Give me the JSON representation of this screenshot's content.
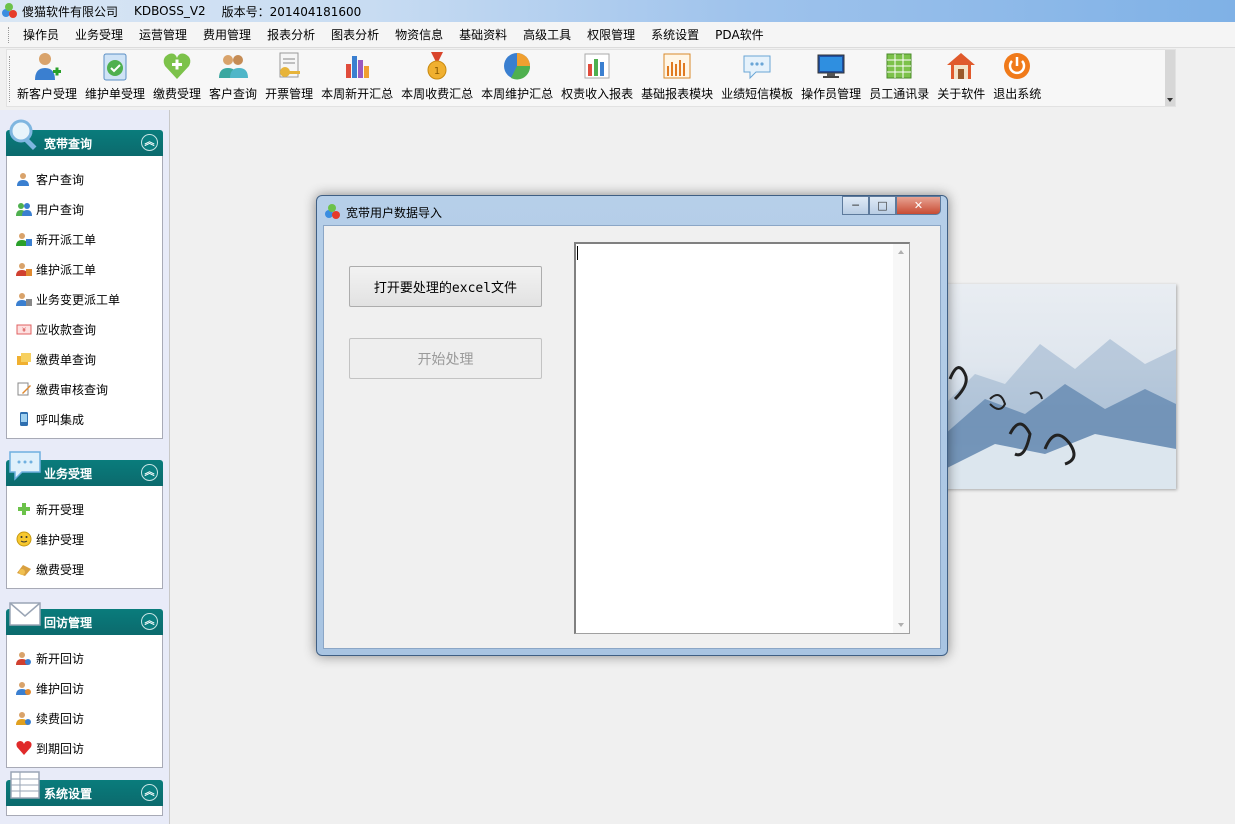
{
  "titlebar": {
    "company": "傻猫软件有限公司",
    "product": "KDBOSS_V2",
    "version": "版本号：201404181600"
  },
  "menu": [
    "操作员",
    "业务受理",
    "运营管理",
    "费用管理",
    "报表分析",
    "图表分析",
    "物资信息",
    "基础资料",
    "高级工具",
    "权限管理",
    "系统设置",
    "PDA软件"
  ],
  "toolbar": [
    {
      "label": "新客户受理",
      "icon": "add-user-icon"
    },
    {
      "label": "维护单受理",
      "icon": "checklist-icon"
    },
    {
      "label": "缴费受理",
      "icon": "heart-plus-icon"
    },
    {
      "label": "客户查询",
      "icon": "users-icon"
    },
    {
      "label": "开票管理",
      "icon": "invoice-key-icon"
    },
    {
      "label": "本周新开汇总",
      "icon": "bar-chart-icon"
    },
    {
      "label": "本周收费汇总",
      "icon": "medal-icon"
    },
    {
      "label": "本周维护汇总",
      "icon": "pie-chart-icon"
    },
    {
      "label": "权责收入报表",
      "icon": "column-chart-icon"
    },
    {
      "label": "基础报表模块",
      "icon": "report-chart-icon"
    },
    {
      "label": "业绩短信模板",
      "icon": "message-bubble-icon"
    },
    {
      "label": "操作员管理",
      "icon": "monitor-icon"
    },
    {
      "label": "员工通讯录",
      "icon": "spreadsheet-icon"
    },
    {
      "label": "关于软件",
      "icon": "home-icon"
    },
    {
      "label": "退出系统",
      "icon": "power-icon"
    }
  ],
  "sidebar": {
    "groups": [
      {
        "title": "宽带查询",
        "icon": "magnifier-icon",
        "items": [
          {
            "label": "客户查询",
            "icon": "customer-icon"
          },
          {
            "label": "用户查询",
            "icon": "group-icon"
          },
          {
            "label": "新开派工单",
            "icon": "new-order-icon"
          },
          {
            "label": "维护派工单",
            "icon": "repair-order-icon"
          },
          {
            "label": "业务变更派工单",
            "icon": "change-order-icon"
          },
          {
            "label": "应收款查询",
            "icon": "receivable-icon"
          },
          {
            "label": "缴费单查询",
            "icon": "payment-icon"
          },
          {
            "label": "缴费审核查询",
            "icon": "audit-icon"
          },
          {
            "label": "呼叫集成",
            "icon": "phone-icon"
          }
        ]
      },
      {
        "title": "业务受理",
        "icon": "chat-bubble-icon",
        "items": [
          {
            "label": "新开受理",
            "icon": "plus-icon"
          },
          {
            "label": "维护受理",
            "icon": "smiley-icon"
          },
          {
            "label": "缴费受理",
            "icon": "money-icon"
          }
        ]
      },
      {
        "title": "回访管理",
        "icon": "envelope-icon",
        "items": [
          {
            "label": "新开回访",
            "icon": "user-red-icon"
          },
          {
            "label": "维护回访",
            "icon": "user-blue-icon"
          },
          {
            "label": "续费回访",
            "icon": "user-gold-icon"
          },
          {
            "label": "到期回访",
            "icon": "heart-icon"
          }
        ]
      },
      {
        "title": "系统设置",
        "icon": "table-icon",
        "items": []
      }
    ]
  },
  "dialog": {
    "title": "宽带用户数据导入",
    "open_button": "打开要处理的excel文件",
    "start_button": "开始处理",
    "log_text": ""
  },
  "colors": {
    "group_header": "#0b7375",
    "panel_bg": "#e8ebf8",
    "dialog_frame": "#b6cfe9"
  }
}
